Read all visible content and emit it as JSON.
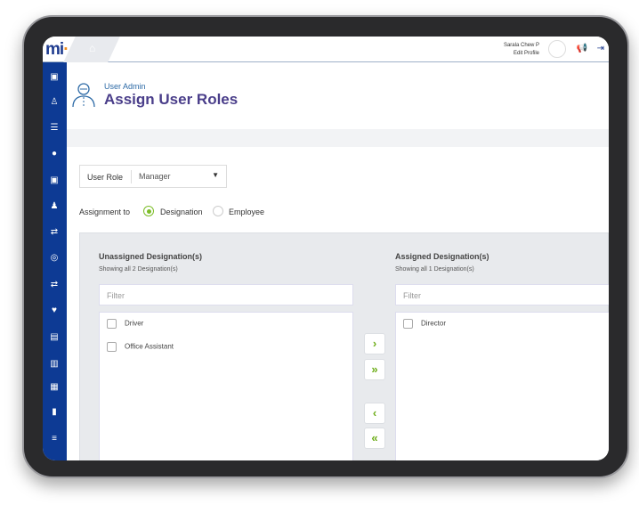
{
  "header": {
    "logo": "mi",
    "user_name": "Sarala Chew P",
    "edit_profile": "Edit Profile"
  },
  "page": {
    "breadcrumb": "User Admin",
    "title": "Assign User Roles"
  },
  "form": {
    "user_role_label": "User Role",
    "user_role_value": "Manager",
    "assignment_label": "Assignment to",
    "options": [
      "Designation",
      "Employee"
    ],
    "selected": "Designation"
  },
  "unassigned": {
    "title": "Unassigned Designation(s)",
    "subtitle": "Showing all 2 Designation(s)",
    "filter_placeholder": "Filter",
    "items": [
      "Driver",
      "Office Assistant"
    ]
  },
  "assigned": {
    "title": "Assigned Designation(s)",
    "subtitle": "Showing all 1 Designation(s)",
    "filter_placeholder": "Filter",
    "items": [
      "Director"
    ]
  },
  "buttons": {
    "move_right": "›",
    "move_all_right": "»",
    "move_left": "‹",
    "move_all_left": "«"
  },
  "colors": {
    "sidebar": "#0d3a94",
    "accent": "#7cbd28",
    "title": "#4a3e8a"
  }
}
